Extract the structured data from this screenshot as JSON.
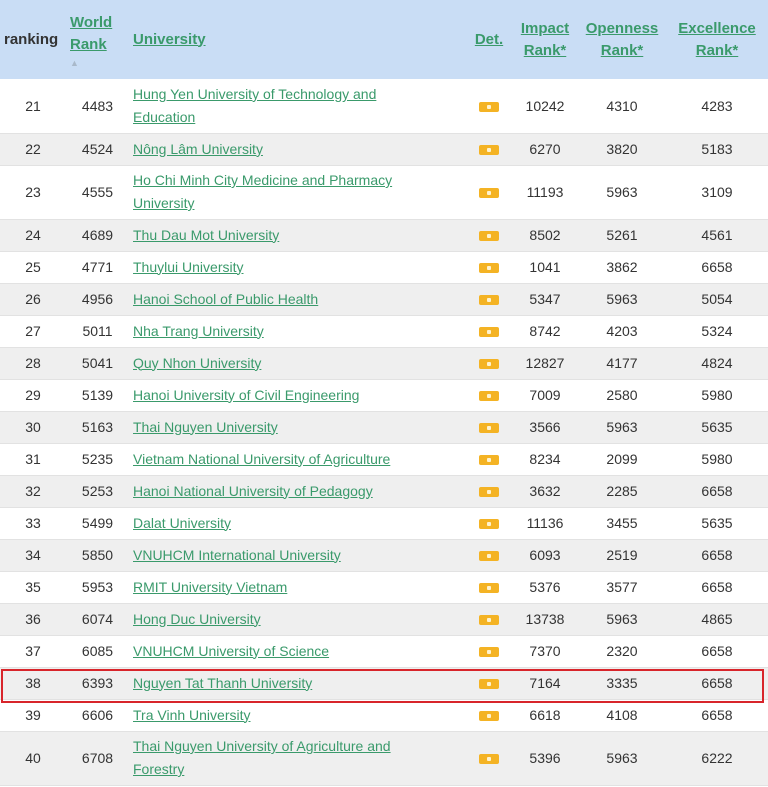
{
  "header": {
    "ranking": "ranking",
    "world_rank_1": "World",
    "world_rank_2": "Rank",
    "sort_icon": "▲",
    "university": "University",
    "det": "Det.",
    "impact_1": "Impact",
    "impact_2": "Rank*",
    "openness_1": "Openness",
    "openness_2": "Rank*",
    "excellence_1": "Excellence",
    "excellence_2": "Rank*"
  },
  "rows": [
    {
      "ranking": "21",
      "world_rank": "4483",
      "university_l1": "Hung Yen University of Technology and",
      "university_l2": "Education",
      "impact": "10242",
      "openness": "4310",
      "excellence": "4283"
    },
    {
      "ranking": "22",
      "world_rank": "4524",
      "university_l1": "Nông Lâm University",
      "university_l2": "",
      "impact": "6270",
      "openness": "3820",
      "excellence": "5183"
    },
    {
      "ranking": "23",
      "world_rank": "4555",
      "university_l1": "Ho Chi Minh City Medicine and Pharmacy",
      "university_l2": "University",
      "impact": "11193",
      "openness": "5963",
      "excellence": "3109"
    },
    {
      "ranking": "24",
      "world_rank": "4689",
      "university_l1": "Thu Dau Mot University",
      "university_l2": "",
      "impact": "8502",
      "openness": "5261",
      "excellence": "4561"
    },
    {
      "ranking": "25",
      "world_rank": "4771",
      "university_l1": "Thuylui University",
      "university_l2": "",
      "impact": "1041",
      "openness": "3862",
      "excellence": "6658"
    },
    {
      "ranking": "26",
      "world_rank": "4956",
      "university_l1": "Hanoi School of Public Health",
      "university_l2": "",
      "impact": "5347",
      "openness": "5963",
      "excellence": "5054"
    },
    {
      "ranking": "27",
      "world_rank": "5011",
      "university_l1": "Nha Trang University",
      "university_l2": "",
      "impact": "8742",
      "openness": "4203",
      "excellence": "5324"
    },
    {
      "ranking": "28",
      "world_rank": "5041",
      "university_l1": "Quy Nhon University",
      "university_l2": "",
      "impact": "12827",
      "openness": "4177",
      "excellence": "4824"
    },
    {
      "ranking": "29",
      "world_rank": "5139",
      "university_l1": "Hanoi University of Civil Engineering",
      "university_l2": "",
      "impact": "7009",
      "openness": "2580",
      "excellence": "5980"
    },
    {
      "ranking": "30",
      "world_rank": "5163",
      "university_l1": "Thai Nguyen University",
      "university_l2": "",
      "impact": "3566",
      "openness": "5963",
      "excellence": "5635"
    },
    {
      "ranking": "31",
      "world_rank": "5235",
      "university_l1": "Vietnam National University of Agriculture",
      "university_l2": "",
      "impact": "8234",
      "openness": "2099",
      "excellence": "5980"
    },
    {
      "ranking": "32",
      "world_rank": "5253",
      "university_l1": "Hanoi National University of Pedagogy",
      "university_l2": "",
      "impact": "3632",
      "openness": "2285",
      "excellence": "6658"
    },
    {
      "ranking": "33",
      "world_rank": "5499",
      "university_l1": "Dalat University",
      "university_l2": "",
      "impact": "11136",
      "openness": "3455",
      "excellence": "5635"
    },
    {
      "ranking": "34",
      "world_rank": "5850",
      "university_l1": "VNUHCM International University",
      "university_l2": "",
      "impact": "6093",
      "openness": "2519",
      "excellence": "6658"
    },
    {
      "ranking": "35",
      "world_rank": "5953",
      "university_l1": "RMIT University Vietnam",
      "university_l2": "",
      "impact": "5376",
      "openness": "3577",
      "excellence": "6658"
    },
    {
      "ranking": "36",
      "world_rank": "6074",
      "university_l1": "Hong Duc University",
      "university_l2": "",
      "impact": "13738",
      "openness": "5963",
      "excellence": "4865"
    },
    {
      "ranking": "37",
      "world_rank": "6085",
      "university_l1": "VNUHCM University of Science",
      "university_l2": "",
      "impact": "7370",
      "openness": "2320",
      "excellence": "6658"
    },
    {
      "ranking": "38",
      "world_rank": "6393",
      "university_l1": "Nguyen Tat Thanh University",
      "university_l2": "",
      "impact": "7164",
      "openness": "3335",
      "excellence": "6658"
    },
    {
      "ranking": "39",
      "world_rank": "6606",
      "university_l1": "Tra Vinh University",
      "university_l2": "",
      "impact": "6618",
      "openness": "4108",
      "excellence": "6658"
    },
    {
      "ranking": "40",
      "world_rank": "6708",
      "university_l1": "Thai Nguyen University of Agriculture and",
      "university_l2": "Forestry",
      "impact": "5396",
      "openness": "5963",
      "excellence": "6222"
    }
  ],
  "colors": {
    "header_bg": "#c9ddf5",
    "link": "#3a9a6b",
    "row_alt": "#efefef",
    "highlight": "#d8252b",
    "det_icon": "#f4b324"
  }
}
